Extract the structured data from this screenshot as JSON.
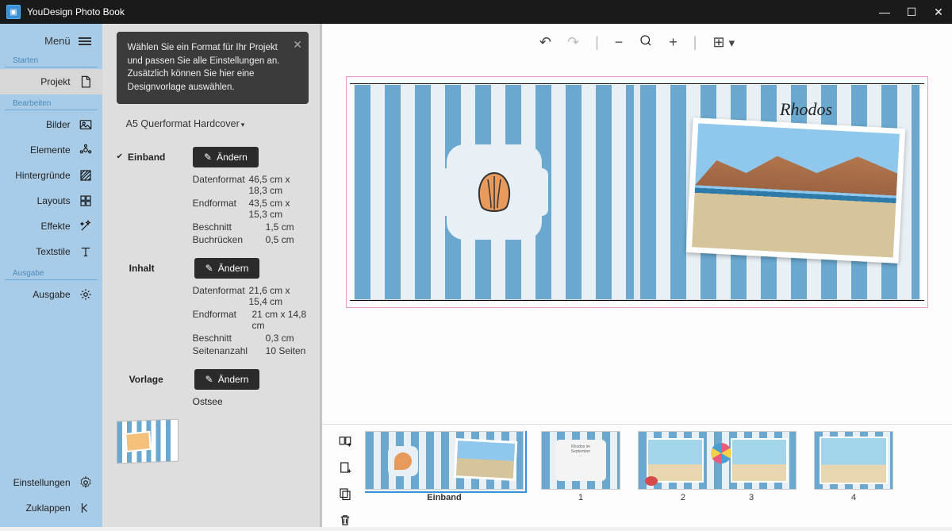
{
  "app": {
    "title": "YouDesign Photo Book"
  },
  "sidebar": {
    "menu": "Menü",
    "sections": [
      "Starten",
      "Bearbeiten",
      "Ausgabe"
    ],
    "items": {
      "projekt": "Projekt",
      "bilder": "Bilder",
      "elemente": "Elemente",
      "hintergruende": "Hintergründe",
      "layouts": "Layouts",
      "effekte": "Effekte",
      "textstile": "Textstile",
      "ausgabe": "Ausgabe",
      "einstellungen": "Einstellungen",
      "zuklappen": "Zuklappen"
    }
  },
  "hint": "Wählen Sie ein Format für Ihr Projekt und passen Sie alle Einstellungen an. Zusätzlich können Sie hier eine Designvorlage auswählen.",
  "format": "A5 Querformat Hardcover",
  "changeBtn": "Ändern",
  "einband": {
    "label": "Einband",
    "rows": [
      {
        "k": "Datenformat",
        "v": "46,5 cm x 18,3 cm"
      },
      {
        "k": "Endformat",
        "v": "43,5 cm x 15,3 cm"
      },
      {
        "k": "Beschnitt",
        "v": "1,5 cm"
      },
      {
        "k": "Buchrücken",
        "v": "0,5 cm"
      }
    ]
  },
  "inhalt": {
    "label": "Inhalt",
    "rows": [
      {
        "k": "Datenformat",
        "v": "21,6 cm x 15,4 cm"
      },
      {
        "k": "Endformat",
        "v": "21 cm x 14,8 cm"
      },
      {
        "k": "Beschnitt",
        "v": "0,3 cm"
      },
      {
        "k": "Seitenanzahl",
        "v": "10 Seiten"
      }
    ]
  },
  "vorlage": {
    "label": "Vorlage",
    "name": "Ostsee"
  },
  "cover": {
    "title": "Rhodos"
  },
  "pages": {
    "labels": [
      "Einband",
      "1",
      "2",
      "3",
      "4"
    ]
  }
}
